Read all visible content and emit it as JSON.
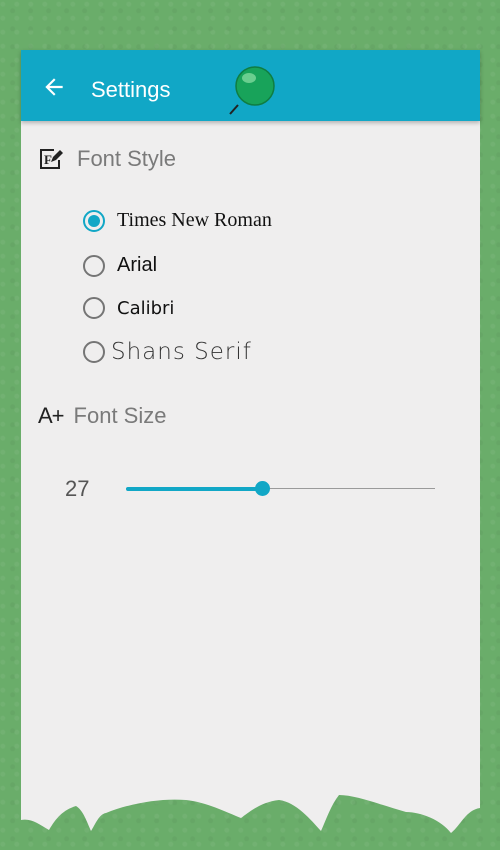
{
  "colors": {
    "accent": "#11a7c6",
    "background": "#6aad6a",
    "paper": "#efeeee"
  },
  "app_bar": {
    "title": "Settings",
    "back_icon": "arrow-left-icon",
    "pin_icon": "green-pin-icon"
  },
  "font_style": {
    "label": "Font Style",
    "icon": "font-edit-icon",
    "options": [
      {
        "label": "Times New Roman",
        "selected": true
      },
      {
        "label": "Arial",
        "selected": false
      },
      {
        "label": "Calibri",
        "selected": false
      },
      {
        "label": "Shans Serif",
        "selected": false
      }
    ]
  },
  "font_size": {
    "label": "Font Size",
    "icon_text": "A+",
    "value": "27",
    "slider_fraction": 0.44
  }
}
